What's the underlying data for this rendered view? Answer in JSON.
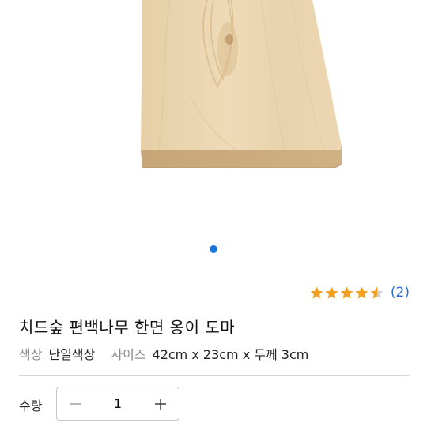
{
  "product": {
    "image_icon": "wooden-cutting-board-image",
    "title": "치드숲 편백나무 한면 옹이 도마",
    "rating": 4.5,
    "review_count": "(2)",
    "options": [
      {
        "key": "색상",
        "value": "단일색상"
      },
      {
        "key": "사이즈",
        "value": "42cm x 23cm x 두께 3cm"
      }
    ]
  },
  "gallery": {
    "active_index": 1,
    "total": 1
  },
  "quantity": {
    "label": "수량",
    "value": "1",
    "minus_icon": "minus-icon",
    "plus_icon": "plus-icon"
  },
  "colors": {
    "accent": "#1a73d9",
    "star": "#f2a01e",
    "star_empty": "#d0d0d0",
    "review_link": "#2a6fd6",
    "wood_light": "#ead5b1",
    "wood_dark": "#c9a677"
  }
}
